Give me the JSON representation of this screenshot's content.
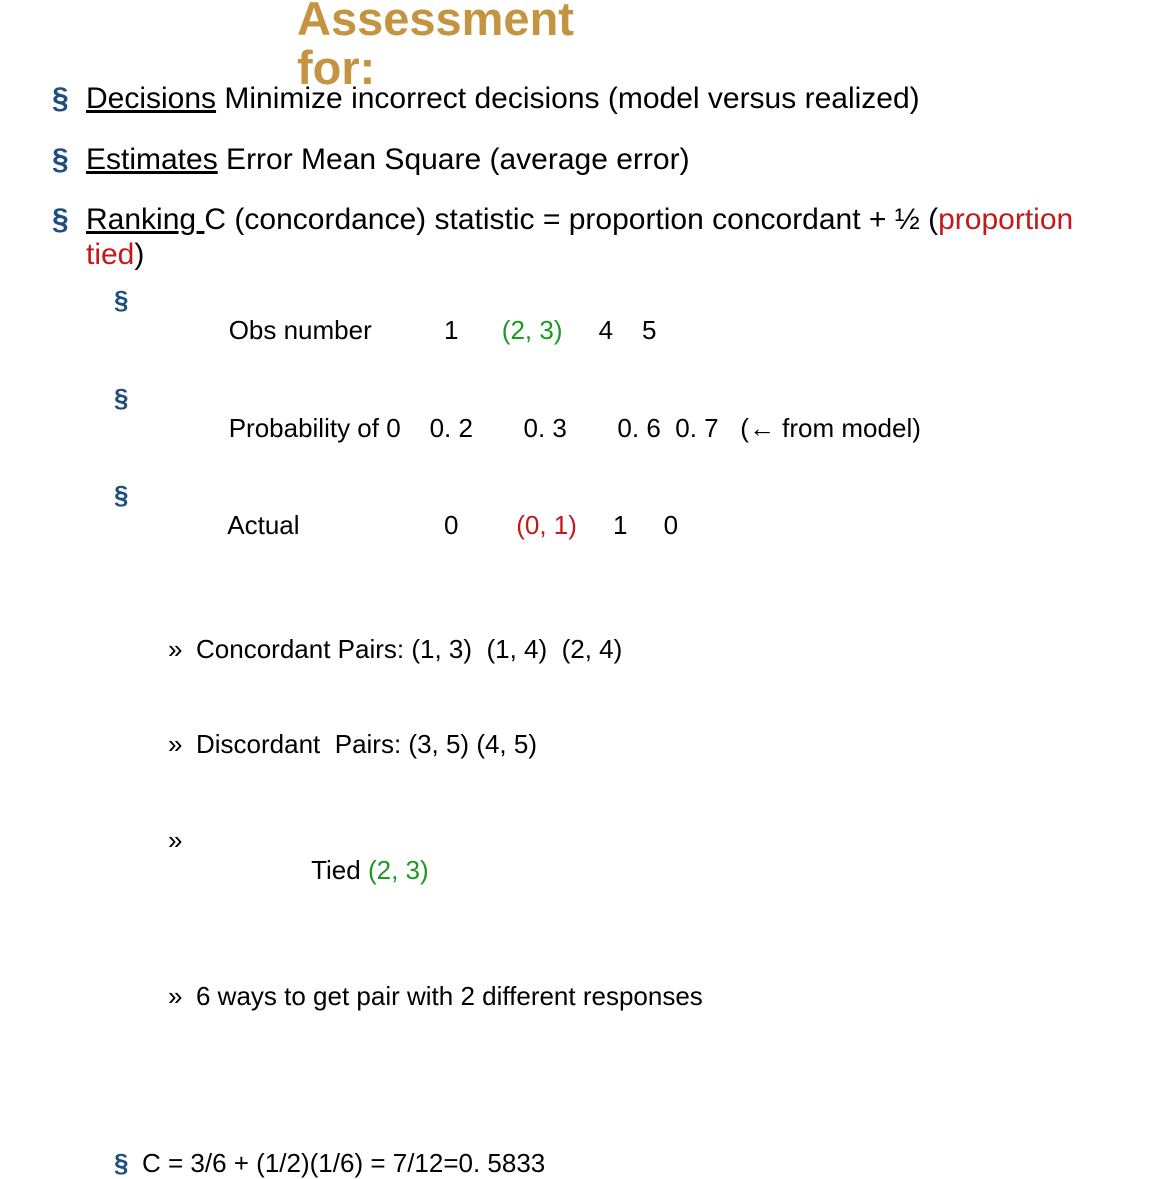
{
  "title_line1": "Assessment",
  "title_line2": "for:",
  "bullets": [
    {
      "term": "Decisions",
      "rest": "  Minimize incorrect decisions (model versus realized)"
    },
    {
      "term": "Estimates",
      "rest": "  Error Mean Square (average error)"
    },
    {
      "term": "Ranking ",
      "rest_a": "C (concordance) statistic = proportion concordant + ½ (",
      "rest_red": "proportion  tied",
      "rest_b": ")",
      "sub": [
        {
          "pre": "Obs number          1      ",
          "grn": "(2, 3)",
          "post": "     4    5"
        },
        {
          "pre": "Probability of 0    0. 2       0. 3       0. 6  0. 7   (",
          "arrow": "←",
          "post2": " from model)"
        },
        {
          "pre": "Actual                    0        ",
          "red": "(0, 1)",
          "post": "     1     0"
        },
        {
          "det": [
            "Concordant Pairs: (1, 3)  (1, 4)  (2, 4)",
            "Discordant  Pairs: (3, 5) (4, 5)"
          ],
          "tied_pre": "Tied ",
          "tied_grn": "(2, 3)",
          "ways": "6 ways to get pair with 2 different responses"
        },
        {
          "c_value": "C = 3/6 + (1/2)(1/6) = 7/12=0. 5833"
        }
      ]
    }
  ]
}
